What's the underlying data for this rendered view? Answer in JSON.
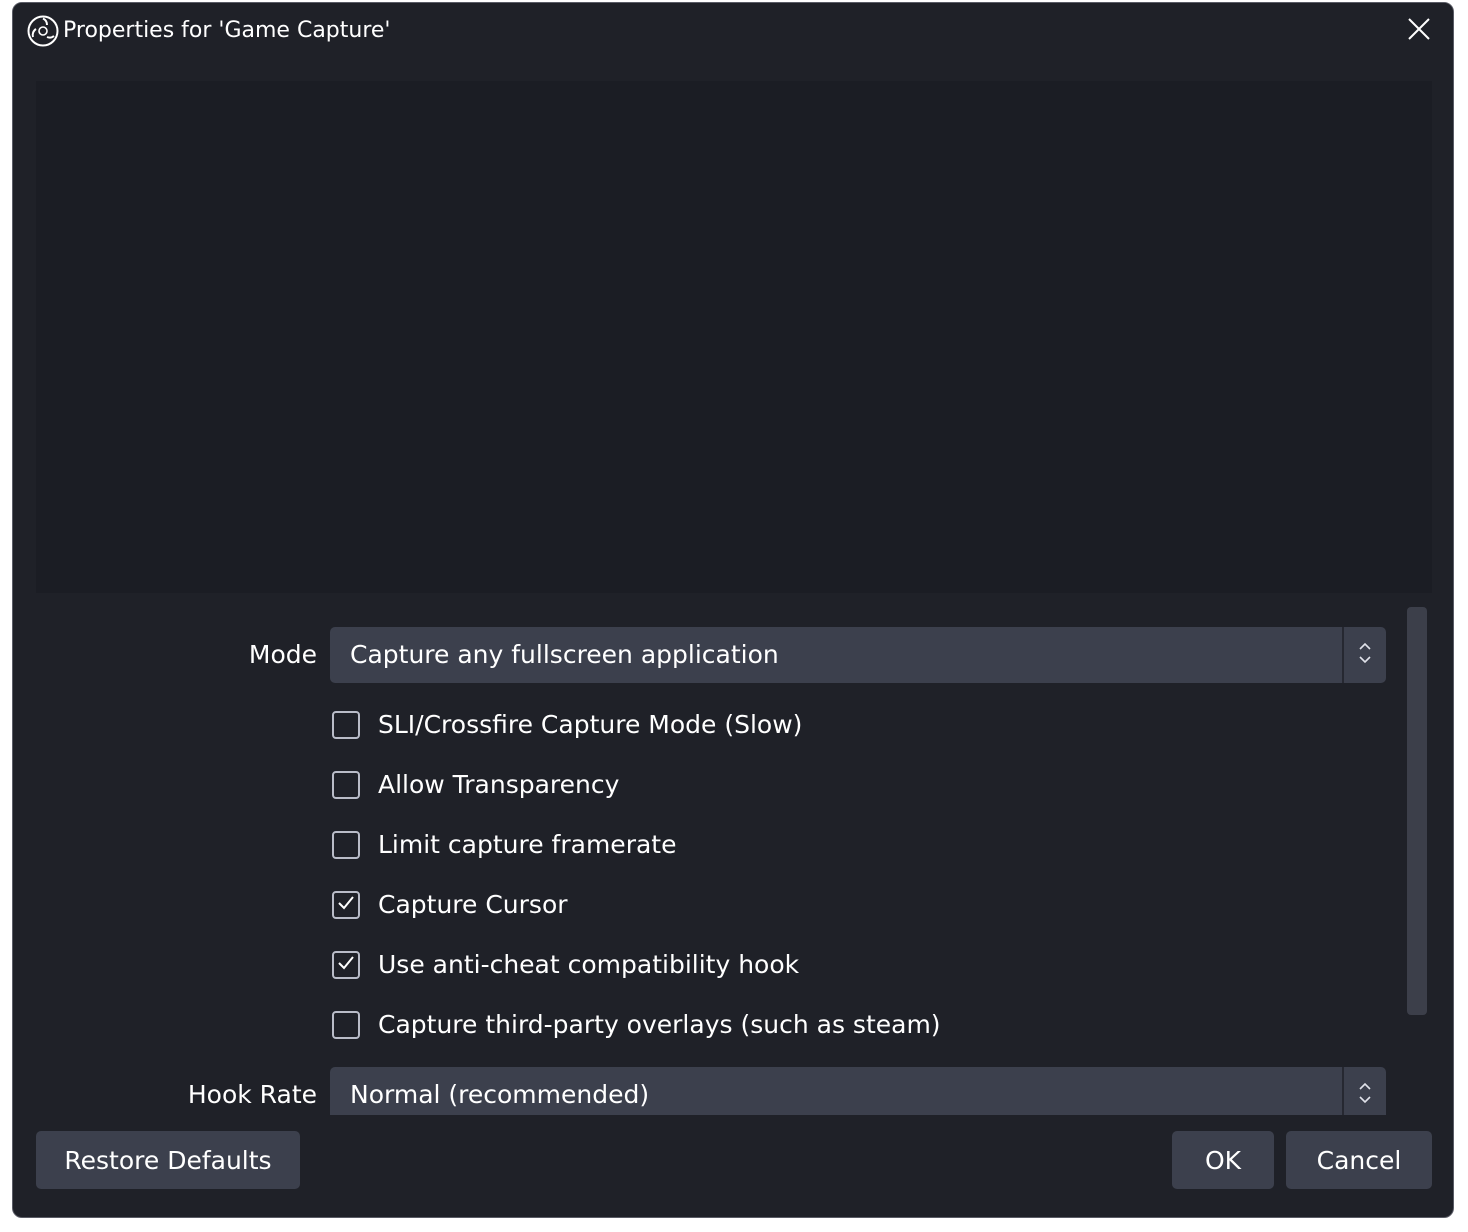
{
  "window": {
    "title": "Properties for 'Game Capture'"
  },
  "icons": {
    "app": "obs-logo-icon",
    "close": "close-icon",
    "combo_arrow": "up-down-chevron-icon",
    "check": "checkmark-icon"
  },
  "colors": {
    "window_bg": "#1f2128",
    "preview_bg": "#1b1d24",
    "control_bg": "#3c404d",
    "text": "#ffffff"
  },
  "properties": {
    "mode": {
      "label": "Mode",
      "value": "Capture any fullscreen application"
    },
    "checkboxes": [
      {
        "label": "SLI/Crossfire Capture Mode (Slow)",
        "checked": false
      },
      {
        "label": "Allow Transparency",
        "checked": false
      },
      {
        "label": "Limit capture framerate",
        "checked": false
      },
      {
        "label": "Capture Cursor",
        "checked": true
      },
      {
        "label": "Use anti-cheat compatibility hook",
        "checked": true
      },
      {
        "label": "Capture third-party overlays (such as steam)",
        "checked": false
      }
    ],
    "hook_rate": {
      "label": "Hook Rate",
      "value": "Normal (recommended)"
    }
  },
  "buttons": {
    "restore_defaults": "Restore Defaults",
    "ok": "OK",
    "cancel": "Cancel"
  }
}
